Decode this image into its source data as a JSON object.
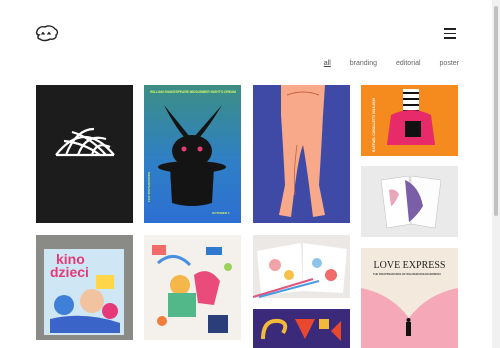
{
  "filters": {
    "all": "all",
    "branding": "branding",
    "editorial": "editorial",
    "poster": "poster",
    "active": "all"
  },
  "posters": {
    "midsummer_header": "WILLIAM SHAKESPEARE  MIDSUMMER NIGHT'S DREAM",
    "midsummer_side": "SHAKESPEARE 2014",
    "midsummer_date": "OCTOBER 4",
    "kino_title_1": "kino",
    "kino_title_2": "dzieci",
    "love_title": "LOVE EXPRESS",
    "love_subtitle": "THE DISAPPEARANCE OF WALDEMAR BARANOWSKI",
    "concert_side": "RAFFAEL CAVALLETTI 2018-2019"
  },
  "colors": {
    "background": "#ffffff",
    "text_muted": "#666666"
  }
}
